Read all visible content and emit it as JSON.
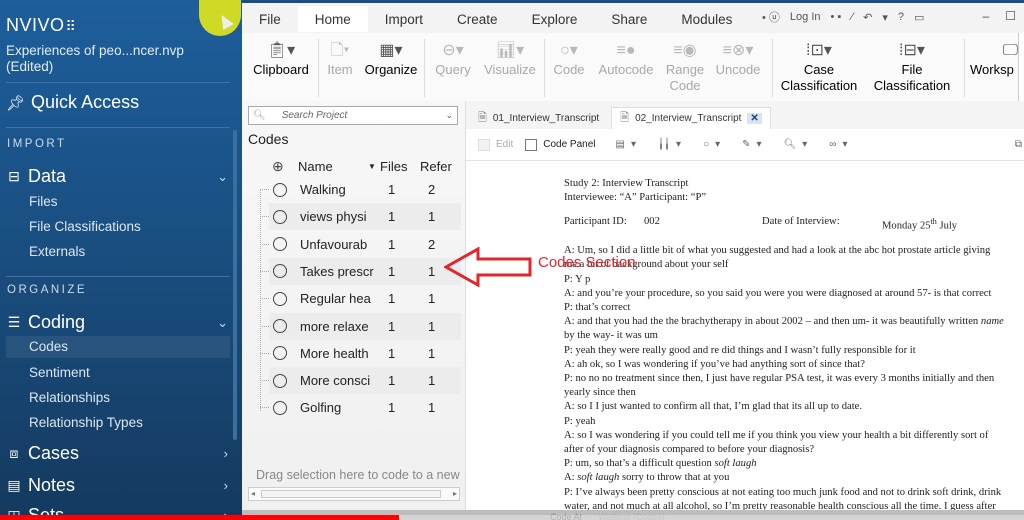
{
  "app": {
    "logo": "NVIVO",
    "logo_mark": "⠿",
    "project_name": "Experiences of peo...ncer.nvp",
    "project_state": "(Edited)"
  },
  "sidebar": {
    "quick_access": "Quick Access",
    "sections": [
      {
        "label": "IMPORT"
      },
      {
        "label": "ORGANIZE"
      }
    ],
    "groups": [
      {
        "label": "Data",
        "icon": "drawer-icon",
        "expanded": true,
        "items": [
          "Files",
          "File Classifications",
          "Externals"
        ]
      },
      {
        "label": "Coding",
        "icon": "coding-icon",
        "expanded": true,
        "items": [
          "Codes",
          "Sentiment",
          "Relationships",
          "Relationship Types"
        ]
      },
      {
        "label": "Cases",
        "icon": "briefcase-icon",
        "expanded": false
      },
      {
        "label": "Notes",
        "icon": "notes-icon",
        "expanded": false
      },
      {
        "label": "Sets",
        "icon": "sets-icon",
        "expanded": false
      }
    ],
    "active_item": "Codes"
  },
  "ribbon": {
    "tabs": [
      "File",
      "Home",
      "Import",
      "Create",
      "Explore",
      "Share",
      "Modules"
    ],
    "active_tab": "Home",
    "quick_access": {
      "login": "Log In",
      "help": "?"
    },
    "buttons": [
      {
        "label": "Clipboard",
        "enabled": true
      },
      {
        "label": "Item",
        "enabled": false
      },
      {
        "label": "Organize",
        "enabled": true
      },
      {
        "label": "Query",
        "enabled": false
      },
      {
        "label": "Visualize",
        "enabled": false
      },
      {
        "label": "Code",
        "enabled": false
      },
      {
        "label": "Autocode",
        "enabled": false
      },
      {
        "label": "Range\nCode",
        "line1": "Range",
        "line2": "Code",
        "enabled": false
      },
      {
        "label": "Uncode",
        "enabled": false
      },
      {
        "label": "Case Classification",
        "line1": "Case",
        "line2": "Classification",
        "enabled": true
      },
      {
        "label": "File Classification",
        "line1": "File",
        "line2": "Classification",
        "enabled": true
      },
      {
        "label": "Worksp",
        "enabled": true
      }
    ]
  },
  "codes_panel": {
    "search_placeholder": "Search Project",
    "title": "Codes",
    "columns": {
      "name": "Name",
      "files": "Files",
      "references": "Refer"
    },
    "rows": [
      {
        "name": "Walking",
        "files": "1",
        "references": "2"
      },
      {
        "name": "views physi",
        "files": "1",
        "references": "1"
      },
      {
        "name": "Unfavourab",
        "files": "1",
        "references": "2"
      },
      {
        "name": "Takes prescr",
        "files": "1",
        "references": "1"
      },
      {
        "name": "Regular hea",
        "files": "1",
        "references": "1"
      },
      {
        "name": "more relaxe",
        "files": "1",
        "references": "1"
      },
      {
        "name": "More health",
        "files": "1",
        "references": "1"
      },
      {
        "name": "More consci",
        "files": "1",
        "references": "1"
      },
      {
        "name": "Golfing",
        "files": "1",
        "references": "1"
      }
    ],
    "drag_hint": "Drag selection here to code to a new"
  },
  "document": {
    "tabs": [
      {
        "label": "01_Interview_Transcript",
        "active": false
      },
      {
        "label": "02_Interview_Transcript",
        "active": true
      }
    ],
    "toolbar": {
      "edit": "Edit",
      "code_panel": "Code Panel"
    },
    "header": {
      "line1": "Study 2: Interview Transcript",
      "line2": "Interviewee: “A” Participant: “P”",
      "participant_label": "Participant ID:",
      "participant_id": "002",
      "date_label": "Date of Interview:",
      "date_prefix": "Monday 25",
      "date_sup": "th",
      "date_suffix": " July"
    },
    "lines": [
      "A: Um, so I did a little bit of what you suggested and had a look at the abc hot prostate article giving",
      "me a bit of background about your self",
      "P: Y p",
      "A: and you’re your procedure, so you said you were you were diagnosed at around 57- is that correct",
      "P: that’s correct",
      "A: and that you had the the brachytherapy in about 2002 – and then um- it was beautifully written name",
      "by the way- it was um",
      "P: yeah they were really good and re did things and I wasn’t fully responsible for it",
      "A: ah ok, so I was wondering if you’ve had anything sort of since that?",
      "P: no no no treatment since then, I just have regular PSA test, it was every 3 months initially and then",
      "yearly since then",
      "A: so I I just wanted to confirm all that, I’m glad that its all up to date.",
      "P: yeah",
      "A: so I was wondering if you could tell me if you think you view your health a bit differently sort of",
      "after of your diagnosis compared to before your diagnosis?",
      "P: um, so that’s a difficult question soft laugh",
      "A: soft laugh sorry to throw that at you",
      "P: I’ve always been pretty conscious at not eating too much junk food and not to drink soft drink, drink",
      "water, and not much at all alcohol, so I’m pretty reasonable health conscious all the time. I guess after"
    ]
  },
  "annotation": {
    "label": "Codes Section",
    "color": "#e0262b"
  },
  "bottom": {
    "code_at_label": "Code At",
    "code_at_value": "Walking (Codes)"
  },
  "video_progress": 0.39,
  "colors": {
    "sidebar_bg": "#1a4f82",
    "accent_red": "#e0262b"
  }
}
